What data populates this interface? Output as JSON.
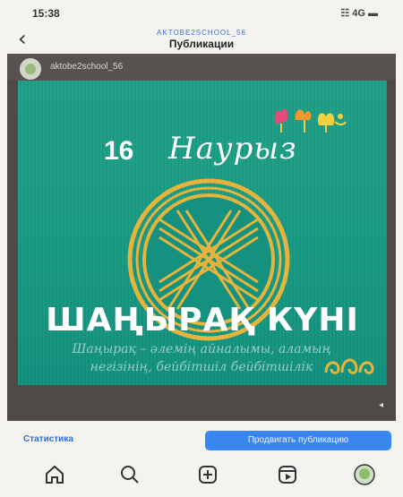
{
  "status_bar": {
    "time": "15:38",
    "signal": "☷ 4G ▬"
  },
  "header": {
    "account": "AKTOBE2SCHOOL_56",
    "title": "Публикации",
    "back_icon": "chevron-left-icon"
  },
  "post": {
    "username": "aktobe2school_56",
    "poster": {
      "day": "16",
      "month": "Наурыз",
      "headline": "ШАҢЫРАҚ КҮНІ",
      "caption_line1": "Шаңырақ – әлемің айналымы, аламың",
      "caption_line2": "негізінің, бейбітшіл бейбітшілік"
    }
  },
  "actions": {
    "stats_label": "Статистика",
    "promote_label": "Продвигать публикацию"
  },
  "nav": {
    "items": [
      "home-icon",
      "search-icon",
      "add-post-icon",
      "reels-icon",
      "profile-avatar"
    ]
  },
  "colors": {
    "poster_bg": "#179a82",
    "accent_blue": "#3a86f0",
    "emblem_gold": "#e6b43c"
  }
}
